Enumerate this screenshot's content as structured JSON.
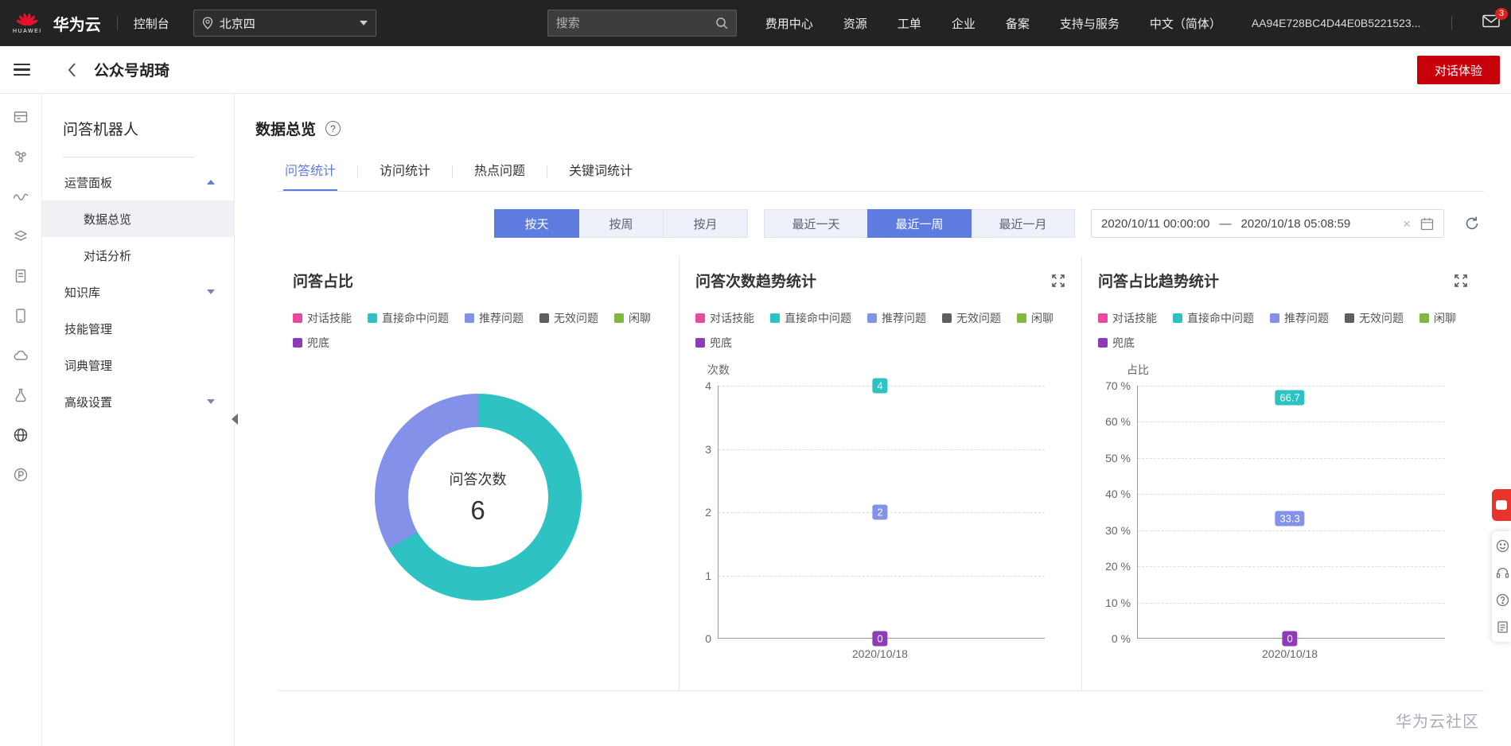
{
  "colors": {
    "accent": "#5e7ce0",
    "brand-red": "#c7000b",
    "badge-red": "#e02020",
    "topbar-bg": "#232323"
  },
  "topbar": {
    "logo_word": "HUAWEI",
    "brand": "华为云",
    "console": "控制台",
    "region": "北京四",
    "search_placeholder": "搜索",
    "menu": [
      "费用中心",
      "资源",
      "工单",
      "企业",
      "备案",
      "支持与服务",
      "中文（简体）",
      "AA94E728BC4D44E0B5221523..."
    ],
    "message_badge": "3"
  },
  "header": {
    "title": "公众号胡琦",
    "action": "对话体验"
  },
  "sidebar": {
    "title": "问答机器人",
    "items": [
      {
        "label": "运营面板"
      },
      {
        "label": "数据总览"
      },
      {
        "label": "对话分析"
      },
      {
        "label": "知识库"
      },
      {
        "label": "技能管理"
      },
      {
        "label": "词典管理"
      },
      {
        "label": "高级设置"
      }
    ]
  },
  "main": {
    "page_title": "数据总览",
    "tabs": [
      "问答统计",
      "访问统计",
      "热点问题",
      "关键词统计"
    ],
    "granularity": [
      "按天",
      "按周",
      "按月"
    ],
    "range": [
      "最近一天",
      "最近一周",
      "最近一月"
    ],
    "date": {
      "start": "2020/10/11 00:00:00",
      "separator": "—",
      "end": "2020/10/18 05:08:59"
    }
  },
  "icons": {
    "help": "?",
    "clear": "×"
  },
  "legend": {
    "items": [
      {
        "label": "对话技能",
        "color": "#e64ba0"
      },
      {
        "label": "直接命中问题",
        "color": "#2fc2c2"
      },
      {
        "label": "推荐问题",
        "color": "#8491e8"
      },
      {
        "label": "无效问题",
        "color": "#5f5f5f"
      },
      {
        "label": "闲聊",
        "color": "#7fb93f"
      },
      {
        "label": "兜底",
        "color": "#8d3bb8"
      }
    ]
  },
  "chart_data": [
    {
      "type": "pie",
      "title": "问答占比",
      "center_label": "问答次数",
      "center_value": "6",
      "slices": [
        {
          "label": "直接命中问题",
          "value": 66.7,
          "color": "#2fc2c2"
        },
        {
          "label": "推荐问题",
          "value": 33.3,
          "color": "#8491e8"
        }
      ]
    },
    {
      "type": "scatter",
      "title": "问答次数趋势统计",
      "ylabel": "次数",
      "ylim": [
        0,
        4
      ],
      "yticks": [
        0,
        1,
        2,
        3,
        4
      ],
      "ytick_labels": [
        "0",
        "1",
        "2",
        "3",
        "4"
      ],
      "x": [
        "2020/10/18"
      ],
      "x_fraction": 0.495,
      "grid": "dashed",
      "series": [
        {
          "name": "直接命中问题",
          "value": 4,
          "label": "4",
          "color": "#2fc2c2"
        },
        {
          "name": "推荐问题",
          "value": 2,
          "label": "2",
          "color": "#8491e8"
        },
        {
          "name": "兜底",
          "value": 0,
          "label": "0",
          "color": "#8d3bb8"
        }
      ]
    },
    {
      "type": "scatter",
      "title": "问答占比趋势统计",
      "ylabel": "占比",
      "ylim": [
        0,
        70
      ],
      "yticks": [
        0,
        10,
        20,
        30,
        40,
        50,
        60,
        70
      ],
      "ytick_labels": [
        "0 %",
        "10 %",
        "20 %",
        "30 %",
        "40 %",
        "50 %",
        "60 %",
        "70 %"
      ],
      "x": [
        "2020/10/18"
      ],
      "x_fraction": 0.495,
      "grid": "dashed",
      "series": [
        {
          "name": "直接命中问题",
          "value": 66.7,
          "label": "66.7",
          "color": "#2fc2c2"
        },
        {
          "name": "推荐问题",
          "value": 33.3,
          "label": "33.3",
          "color": "#8491e8"
        },
        {
          "name": "兜底",
          "value": 0,
          "label": "0",
          "color": "#8d3bb8"
        }
      ]
    }
  ],
  "footer": {
    "watermark": "华为云社区"
  }
}
